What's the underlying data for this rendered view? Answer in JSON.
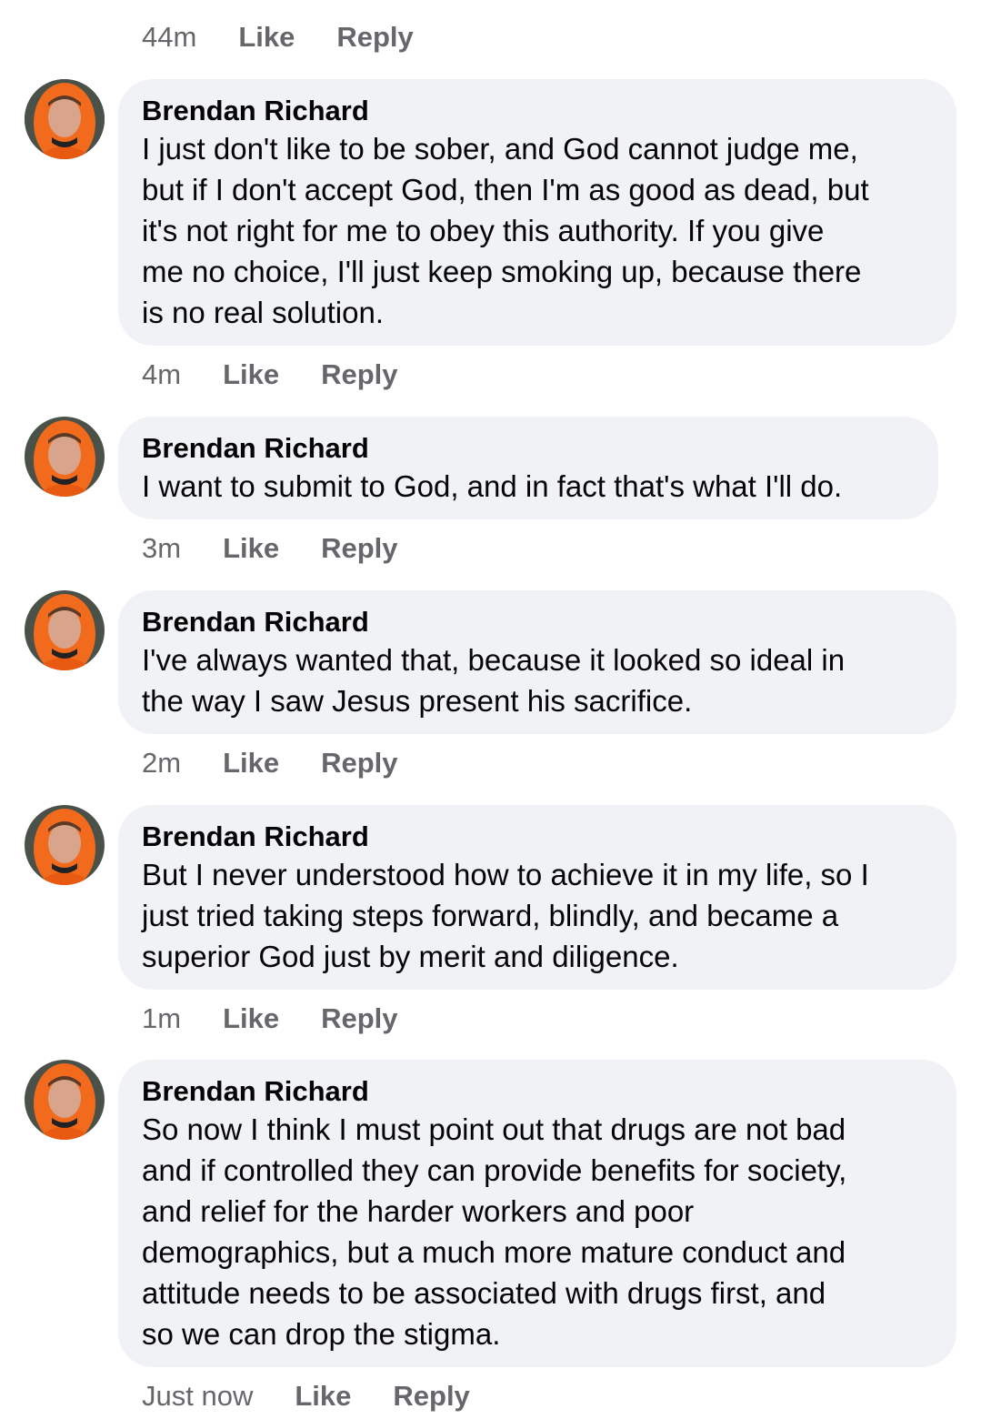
{
  "accent_colors": {
    "bubble_bg": "#f0f2f5",
    "meta_text": "#65676b",
    "text": "#050505",
    "avatar_hood": "#f26b1d"
  },
  "top_actions": {
    "time": "44m",
    "like": "Like",
    "reply": "Reply"
  },
  "comments": [
    {
      "author": "Brendan Richard",
      "text": "I just don't like to be sober, and God cannot judge me,\nbut if I don't accept God, then I'm as good as dead, but\nit's not right for me to obey this authority. If you give\nme no choice, I'll just keep smoking up, because there\nis no real solution.",
      "time": "4m",
      "like": "Like",
      "reply": "Reply",
      "avatar_icon": "profile-photo-icon"
    },
    {
      "author": "Brendan Richard",
      "text": "I want to submit to God, and in fact that's what I'll do.",
      "time": "3m",
      "like": "Like",
      "reply": "Reply",
      "avatar_icon": "profile-photo-icon"
    },
    {
      "author": "Brendan Richard",
      "text": "I've always wanted that, because it looked so ideal in\nthe way I saw Jesus present his sacrifice.",
      "time": "2m",
      "like": "Like",
      "reply": "Reply",
      "avatar_icon": "profile-photo-icon"
    },
    {
      "author": "Brendan Richard",
      "text": "But I never understood how to achieve it in my life, so I\njust tried taking steps forward, blindly, and became a\nsuperior God just by merit and diligence.",
      "time": "1m",
      "like": "Like",
      "reply": "Reply",
      "avatar_icon": "profile-photo-icon"
    },
    {
      "author": "Brendan Richard",
      "text": "So now I think I must point out that drugs are not bad\nand if controlled they can provide benefits for society,\nand relief for the harder workers and poor\ndemographics, but a much more mature conduct and\nattitude needs to be associated with drugs first, and\nso we can drop the stigma.",
      "time": "Just now",
      "like": "Like",
      "reply": "Reply",
      "avatar_icon": "profile-photo-icon"
    }
  ]
}
